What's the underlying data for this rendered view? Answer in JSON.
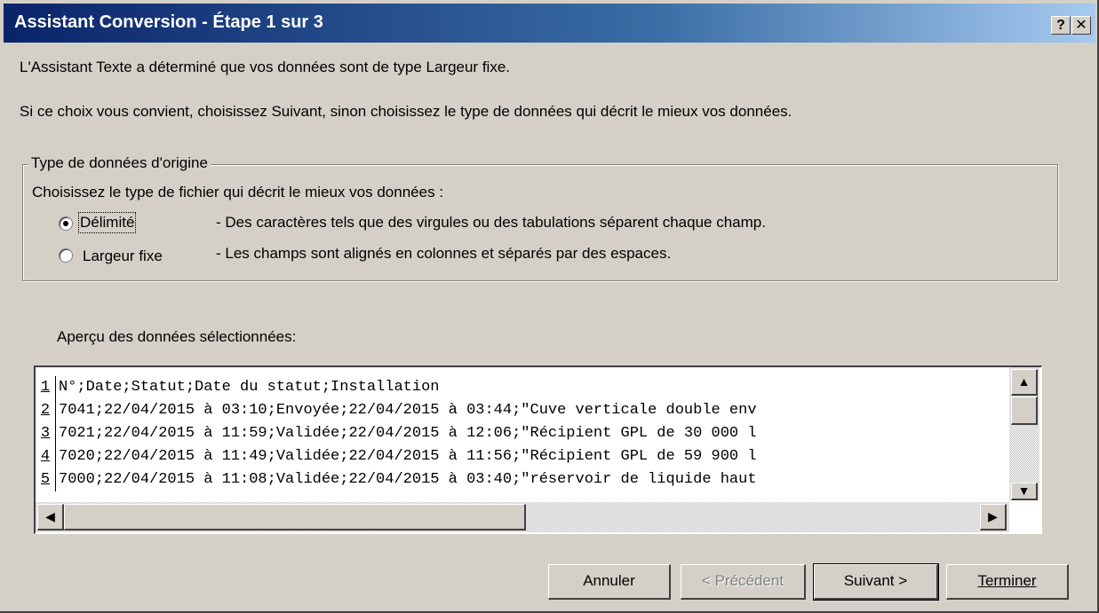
{
  "window": {
    "title": "Assistant Conversion - Étape 1 sur 3",
    "help_label": "?",
    "close_label": "✕"
  },
  "intro": {
    "line1": "L'Assistant Texte a déterminé que vos données sont de type Largeur fixe.",
    "line2": "Si ce choix vous convient, choisissez Suivant, sinon choisissez le type de données qui décrit le mieux vos données."
  },
  "group": {
    "label": "Type de données d'origine",
    "prompt": "Choisissez le type de fichier qui décrit le mieux vos données :",
    "options": [
      {
        "label": "Délimité",
        "description": "- Des caractères tels que des virgules ou des tabulations séparent chaque champ.",
        "selected": true
      },
      {
        "label": "Largeur fixe",
        "description": "- Les champs sont alignés en colonnes et séparés par des espaces.",
        "selected": false
      }
    ]
  },
  "preview": {
    "label": "Aperçu des données sélectionnées:",
    "rows": [
      {
        "num": "1",
        "text": "N°;Date;Statut;Date du statut;Installation"
      },
      {
        "num": "2",
        "text": "7041;22/04/2015 à 03:10;Envoyée;22/04/2015 à 03:44;\"Cuve verticale double env"
      },
      {
        "num": "3",
        "text": "7021;22/04/2015 à 11:59;Validée;22/04/2015 à 12:06;\"Récipient GPL de 30 000 l"
      },
      {
        "num": "4",
        "text": "7020;22/04/2015 à 11:49;Validée;22/04/2015 à 11:56;\"Récipient GPL de 59 900 l"
      },
      {
        "num": "5",
        "text": "7000;22/04/2015 à 11:08;Validée;22/04/2015 à 03:40;\"réservoir de liquide haut"
      }
    ]
  },
  "buttons": {
    "cancel": "Annuler",
    "previous": "< Précédent",
    "next": "Suivant >",
    "finish": "Terminer"
  },
  "icons": {
    "up": "▲",
    "down": "▼",
    "left": "◀",
    "right": "▶"
  }
}
